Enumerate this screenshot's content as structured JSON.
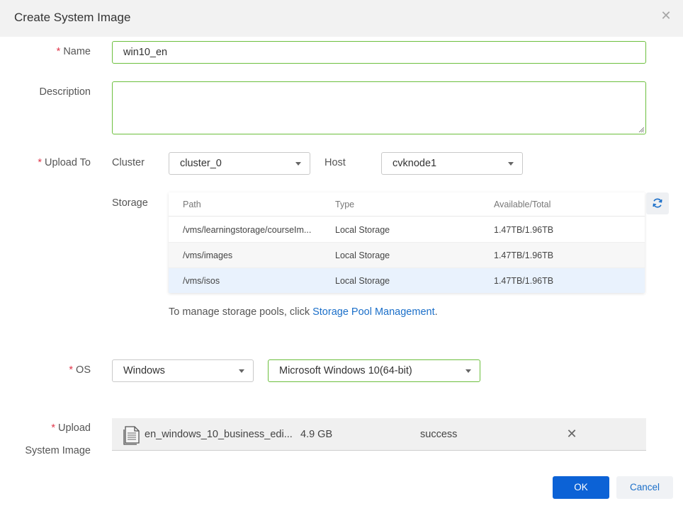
{
  "dialog": {
    "title": "Create System Image"
  },
  "name": {
    "label": "Name",
    "value": "win10_en"
  },
  "description": {
    "label": "Description",
    "value": ""
  },
  "upload_to": {
    "label": "Upload To",
    "cluster_label": "Cluster",
    "cluster_value": "cluster_0",
    "host_label": "Host",
    "host_value": "cvknode1"
  },
  "storage": {
    "label": "Storage",
    "columns": [
      "Path",
      "Type",
      "Available/Total"
    ],
    "rows": [
      {
        "path": "/vms/learningstorage/courseIm...",
        "type": "Local Storage",
        "capacity": "1.47TB/1.96TB"
      },
      {
        "path": "/vms/images",
        "type": "Local Storage",
        "capacity": "1.47TB/1.96TB"
      },
      {
        "path": "/vms/isos",
        "type": "Local Storage",
        "capacity": "1.47TB/1.96TB"
      }
    ],
    "hint_prefix": "To manage storage pools, click ",
    "hint_link": "Storage Pool Management",
    "hint_suffix": "."
  },
  "os": {
    "label": "OS",
    "family": "Windows",
    "version": "Microsoft Windows 10(64-bit)"
  },
  "upload_image": {
    "label_line1": "Upload",
    "label_line2": "System Image",
    "file_name": "en_windows_10_business_edi...",
    "file_size": "4.9 GB",
    "status": "success"
  },
  "footer": {
    "ok_label": "OK",
    "cancel_label": "Cancel"
  },
  "colors": {
    "accent": "#0c62d6",
    "valid_border": "#6cbf3d",
    "required": "#e0374b",
    "link": "#1b6fc9",
    "selected_row": "#e9f2fd"
  }
}
